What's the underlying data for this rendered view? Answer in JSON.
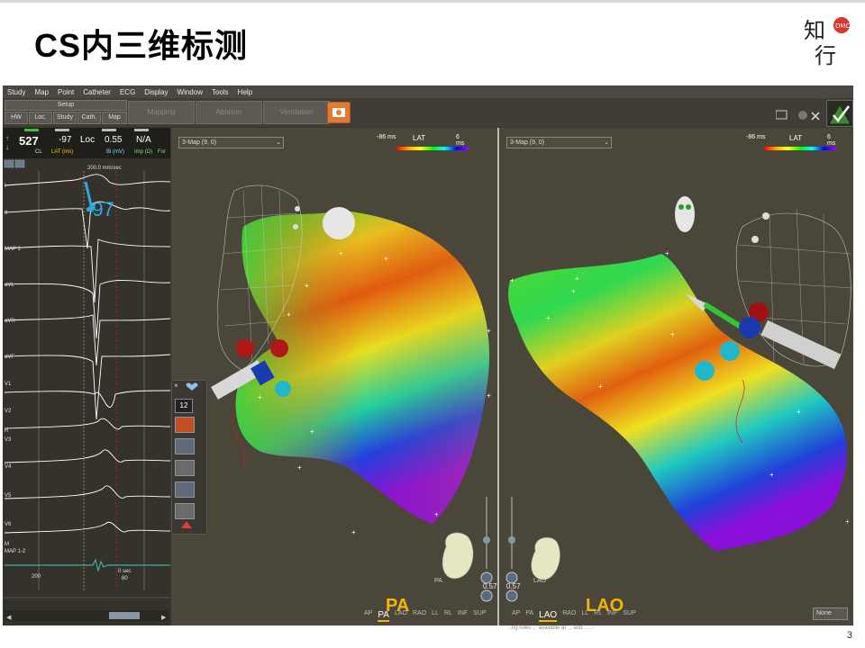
{
  "slide": {
    "title": "CS内三维标测",
    "page_number": "3",
    "logo_text": "知行",
    "logo_badge": "DMC",
    "footnote": "...ng rules ... available at ... and ... ..."
  },
  "menu": [
    "Study",
    "Map",
    "Point",
    "Catheter",
    "ECG",
    "Display",
    "Window",
    "Tools",
    "Help"
  ],
  "toolbar": {
    "setup_label": "Setup",
    "small_buttons": [
      "HW",
      "Loc.",
      "Study",
      "Cath.",
      "Map"
    ],
    "big_buttons": [
      "Mapping",
      "Ablation",
      "Ventilation"
    ]
  },
  "ecg": {
    "cl_value": "527",
    "cl_label": "CL",
    "lat_value": "-97",
    "lat_label": "LAT (ms)",
    "loc_label": "Loc",
    "bi_value": "0.55",
    "bi_label": "Bi (mV)",
    "imp_value": "N/A",
    "imp_label": "Imp (Ω)",
    "for_label": "For",
    "sweep": "200.0 mm/sec",
    "annotation": "-97",
    "leads": [
      "I",
      "II",
      "MAP 1",
      "aVL",
      "aVR",
      "aVF",
      "V1",
      "V2",
      "V3",
      "R",
      "V4",
      "V5",
      "V6",
      "M",
      "MAP 1-2"
    ],
    "scale_left": "200",
    "scale_right": "0 sec",
    "scale_right2": "80"
  },
  "views": {
    "left": {
      "map_name": "3-Map (9, 0)",
      "lat_min": "-86 ms",
      "lat_title": "LAT",
      "lat_max": "6 ms",
      "tag": "PA",
      "mini_tag": "PA",
      "zoom": "0.57",
      "view_options": [
        "AP",
        "PA",
        "LAO",
        "RAO",
        "LL",
        "RL",
        "INF",
        "SUP"
      ],
      "active_view": "PA"
    },
    "right": {
      "map_name": "3-Map (9, 0)",
      "lat_min": "-86 ms",
      "lat_title": "LAT",
      "lat_max": "6 ms",
      "tag": "LAO",
      "mini_tag": "LAO",
      "zoom": "0.57",
      "view_options": [
        "AP",
        "PA",
        "LAO",
        "RAO",
        "LL",
        "RL",
        "INF",
        "SUP"
      ],
      "active_view": "LAO",
      "none_select": "None"
    }
  },
  "tools": {
    "channel_number": "12"
  },
  "colors": {
    "accent_tag": "#f5b400",
    "annotation": "#29a9e0",
    "app_bg": "#3a372f"
  }
}
